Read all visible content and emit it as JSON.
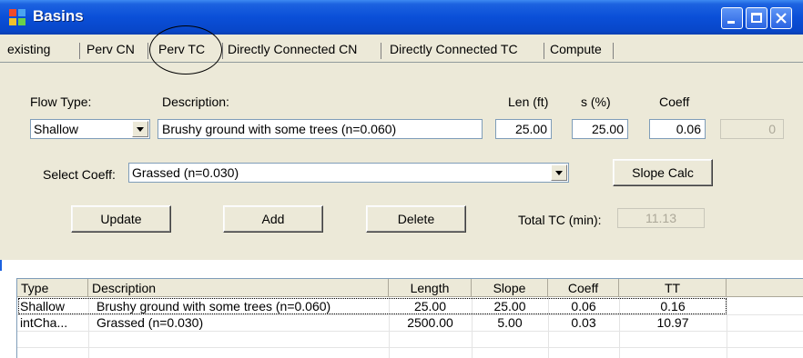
{
  "window": {
    "title": "Basins"
  },
  "tabs": [
    "existing",
    "Perv CN",
    "Perv TC",
    "Directly Connected CN",
    "Directly Connected TC",
    "Compute"
  ],
  "form": {
    "flow_type_label": "Flow Type:",
    "description_label": "Description:",
    "len_label": "Len (ft)",
    "s_label": "s (%)",
    "coeff_label": "Coeff",
    "flow_type_value": "Shallow",
    "description_value": "Brushy ground with some trees (n=0.060)",
    "len_value": "25.00",
    "s_value": "25.00",
    "coeff_value": "0.06",
    "extra_value": "0",
    "select_coeff_label": "Select Coeff:",
    "select_coeff_value": "Grassed (n=0.030)",
    "slope_calc_label": "Slope Calc",
    "update_label": "Update",
    "add_label": "Add",
    "delete_label": "Delete",
    "total_tc_label": "Total TC (min):",
    "total_tc_value": "11.13"
  },
  "table": {
    "columns": [
      "Type",
      "Description",
      "Length",
      "Slope",
      "Coeff",
      "TT"
    ],
    "rows": [
      [
        "Shallow",
        "Brushy ground with some trees (n=0.060)",
        "25.00",
        "25.00",
        "0.06",
        "0.16"
      ],
      [
        "intCha...",
        "Grassed (n=0.030)",
        "2500.00",
        "5.00",
        "0.03",
        "10.97"
      ]
    ]
  }
}
